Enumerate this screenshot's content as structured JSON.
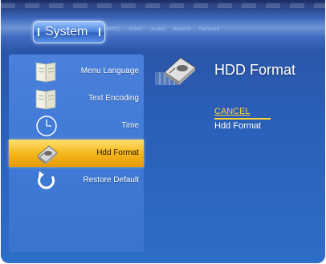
{
  "header": {
    "active_tab": "System",
    "tabs": [
      "MISC",
      "Video",
      "Audio",
      "Record",
      "Network"
    ]
  },
  "sidebar": {
    "items": [
      {
        "label": "Menu Language",
        "icon": "book-icon"
      },
      {
        "label": "Text Encoding",
        "icon": "book-icon"
      },
      {
        "label": "Time",
        "icon": "clock-icon"
      },
      {
        "label": "Hdd Format",
        "icon": "hdd-icon"
      },
      {
        "label": "Restore Default",
        "icon": "refresh-icon"
      }
    ],
    "selected_index": 3
  },
  "content": {
    "title": "HDD Format",
    "options": [
      "CANCEL",
      "Hdd Format"
    ]
  },
  "colors": {
    "background": "#2a5fb8",
    "selection": "#f6b81e",
    "highlight_text": "#ffd23a"
  }
}
